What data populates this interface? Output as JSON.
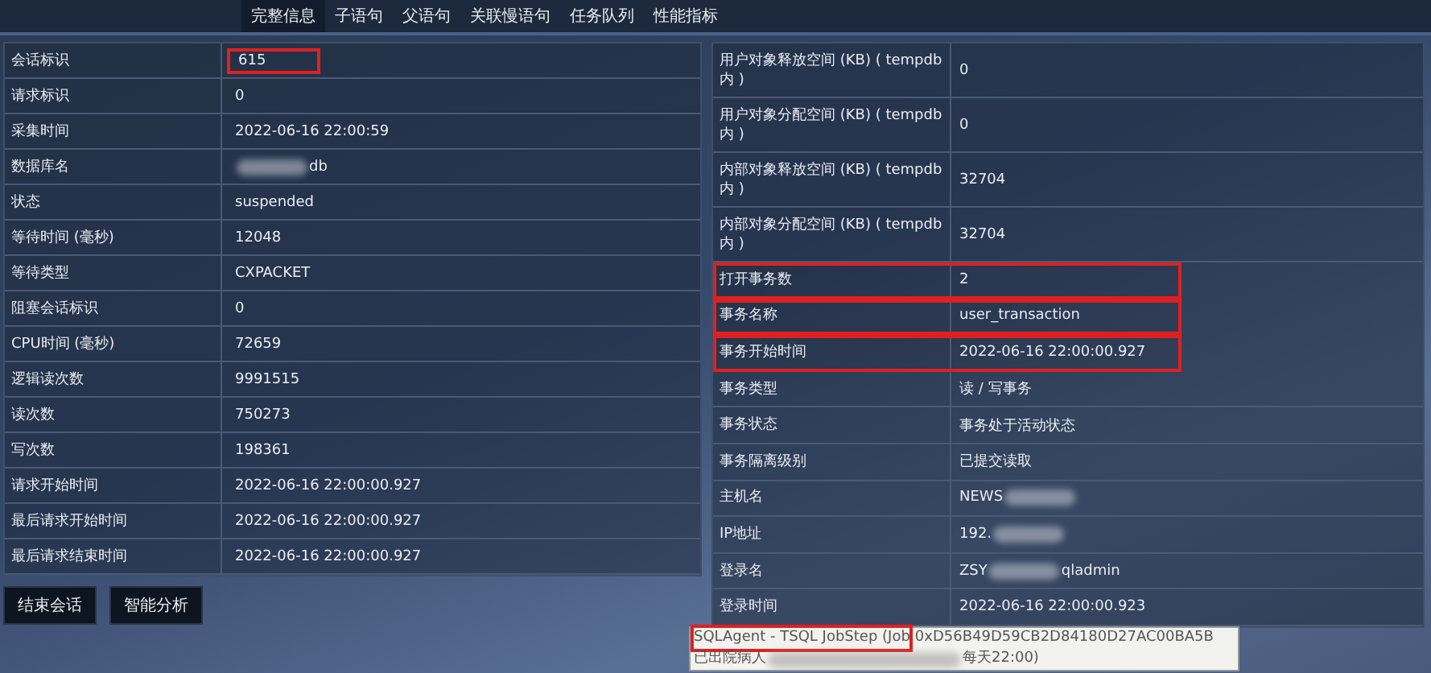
{
  "tabs": [
    {
      "label": "完整信息",
      "selected": true
    },
    {
      "label": "子语句",
      "selected": false
    },
    {
      "label": "父语句",
      "selected": false
    },
    {
      "label": "关联慢语句",
      "selected": false
    },
    {
      "label": "任务队列",
      "selected": false
    },
    {
      "label": "性能指标",
      "selected": false
    }
  ],
  "left_table": [
    {
      "label": "会话标识",
      "value": "615",
      "highlighted": true
    },
    {
      "label": "请求标识",
      "value": "0",
      "highlighted": false
    },
    {
      "label": "采集时间",
      "value": "2022-06-16 22:00:59",
      "highlighted": false
    },
    {
      "label": "数据库名",
      "value": "db",
      "blur_before": true,
      "highlighted": false
    },
    {
      "label": "状态",
      "value": "suspended",
      "highlighted": false
    },
    {
      "label": "等待时间 (毫秒)",
      "value": "12048",
      "highlighted": false
    },
    {
      "label": "等待类型",
      "value": "CXPACKET",
      "highlighted": false
    },
    {
      "label": "阻塞会话标识",
      "value": "0",
      "highlighted": false
    },
    {
      "label": "CPU时间 (毫秒)",
      "value": "72659",
      "highlighted": false
    },
    {
      "label": "逻辑读次数",
      "value": "9991515",
      "highlighted": false
    },
    {
      "label": "读次数",
      "value": "750273",
      "highlighted": false
    },
    {
      "label": "写次数",
      "value": "198361",
      "highlighted": false
    },
    {
      "label": "请求开始时间",
      "value": "2022-06-16 22:00:00.927",
      "highlighted": false
    },
    {
      "label": "最后请求开始时间",
      "value": "2022-06-16 22:00:00.927",
      "highlighted": false
    },
    {
      "label": "最后请求结束时间",
      "value": "2022-06-16 22:00:00.927",
      "highlighted": false
    }
  ],
  "buttons": [
    "结束会话",
    "智能分析"
  ],
  "right_table": [
    {
      "label": "用户对象释放空间 (KB) ( tempdb 内 )",
      "value": "0",
      "highlighted": false
    },
    {
      "label": "用户对象分配空间 (KB) ( tempdb 内 )",
      "value": "0",
      "highlighted": false
    },
    {
      "label": "内部对象释放空间 (KB) ( tempdb 内 )",
      "value": "32704",
      "highlighted": false
    },
    {
      "label": "内部对象分配空间 (KB) ( tempdb 内 )",
      "value": "32704",
      "highlighted": false
    },
    {
      "label": "打开事务数",
      "value": "2",
      "highlighted": true
    },
    {
      "label": "事务名称",
      "value": "user_transaction",
      "highlighted": true
    },
    {
      "label": "事务开始时间",
      "value": "2022-06-16 22:00:00.927",
      "highlighted": true
    },
    {
      "label": "事务类型",
      "value": "读 / 写事务",
      "highlighted": false
    },
    {
      "label": "事务状态",
      "value": "事务处于活动状态",
      "highlighted": false
    },
    {
      "label": "事务隔离级别",
      "value": "已提交读取",
      "highlighted": false
    },
    {
      "label": "主机名",
      "value": "NEWS",
      "blur_after": true,
      "highlighted": false
    },
    {
      "label": "IP地址",
      "value": "192.",
      "blur_after": true,
      "highlighted": false
    },
    {
      "label": "登录名",
      "value": "ZSY",
      "blur_after": true,
      "value_end": "qladmin",
      "highlighted": false
    },
    {
      "label": "登录时间",
      "value": "2022-06-16 22:00:00.923",
      "highlighted": false
    }
  ],
  "tooltip": {
    "program": "SQLAgent - TSQL JobStep (Job",
    "program_highlighted": true,
    "job_id": "0xD56B49D59CB2D84180D27AC00BA5B",
    "line2_start": "已出院病人",
    "line2_end": "每天22:00)"
  }
}
